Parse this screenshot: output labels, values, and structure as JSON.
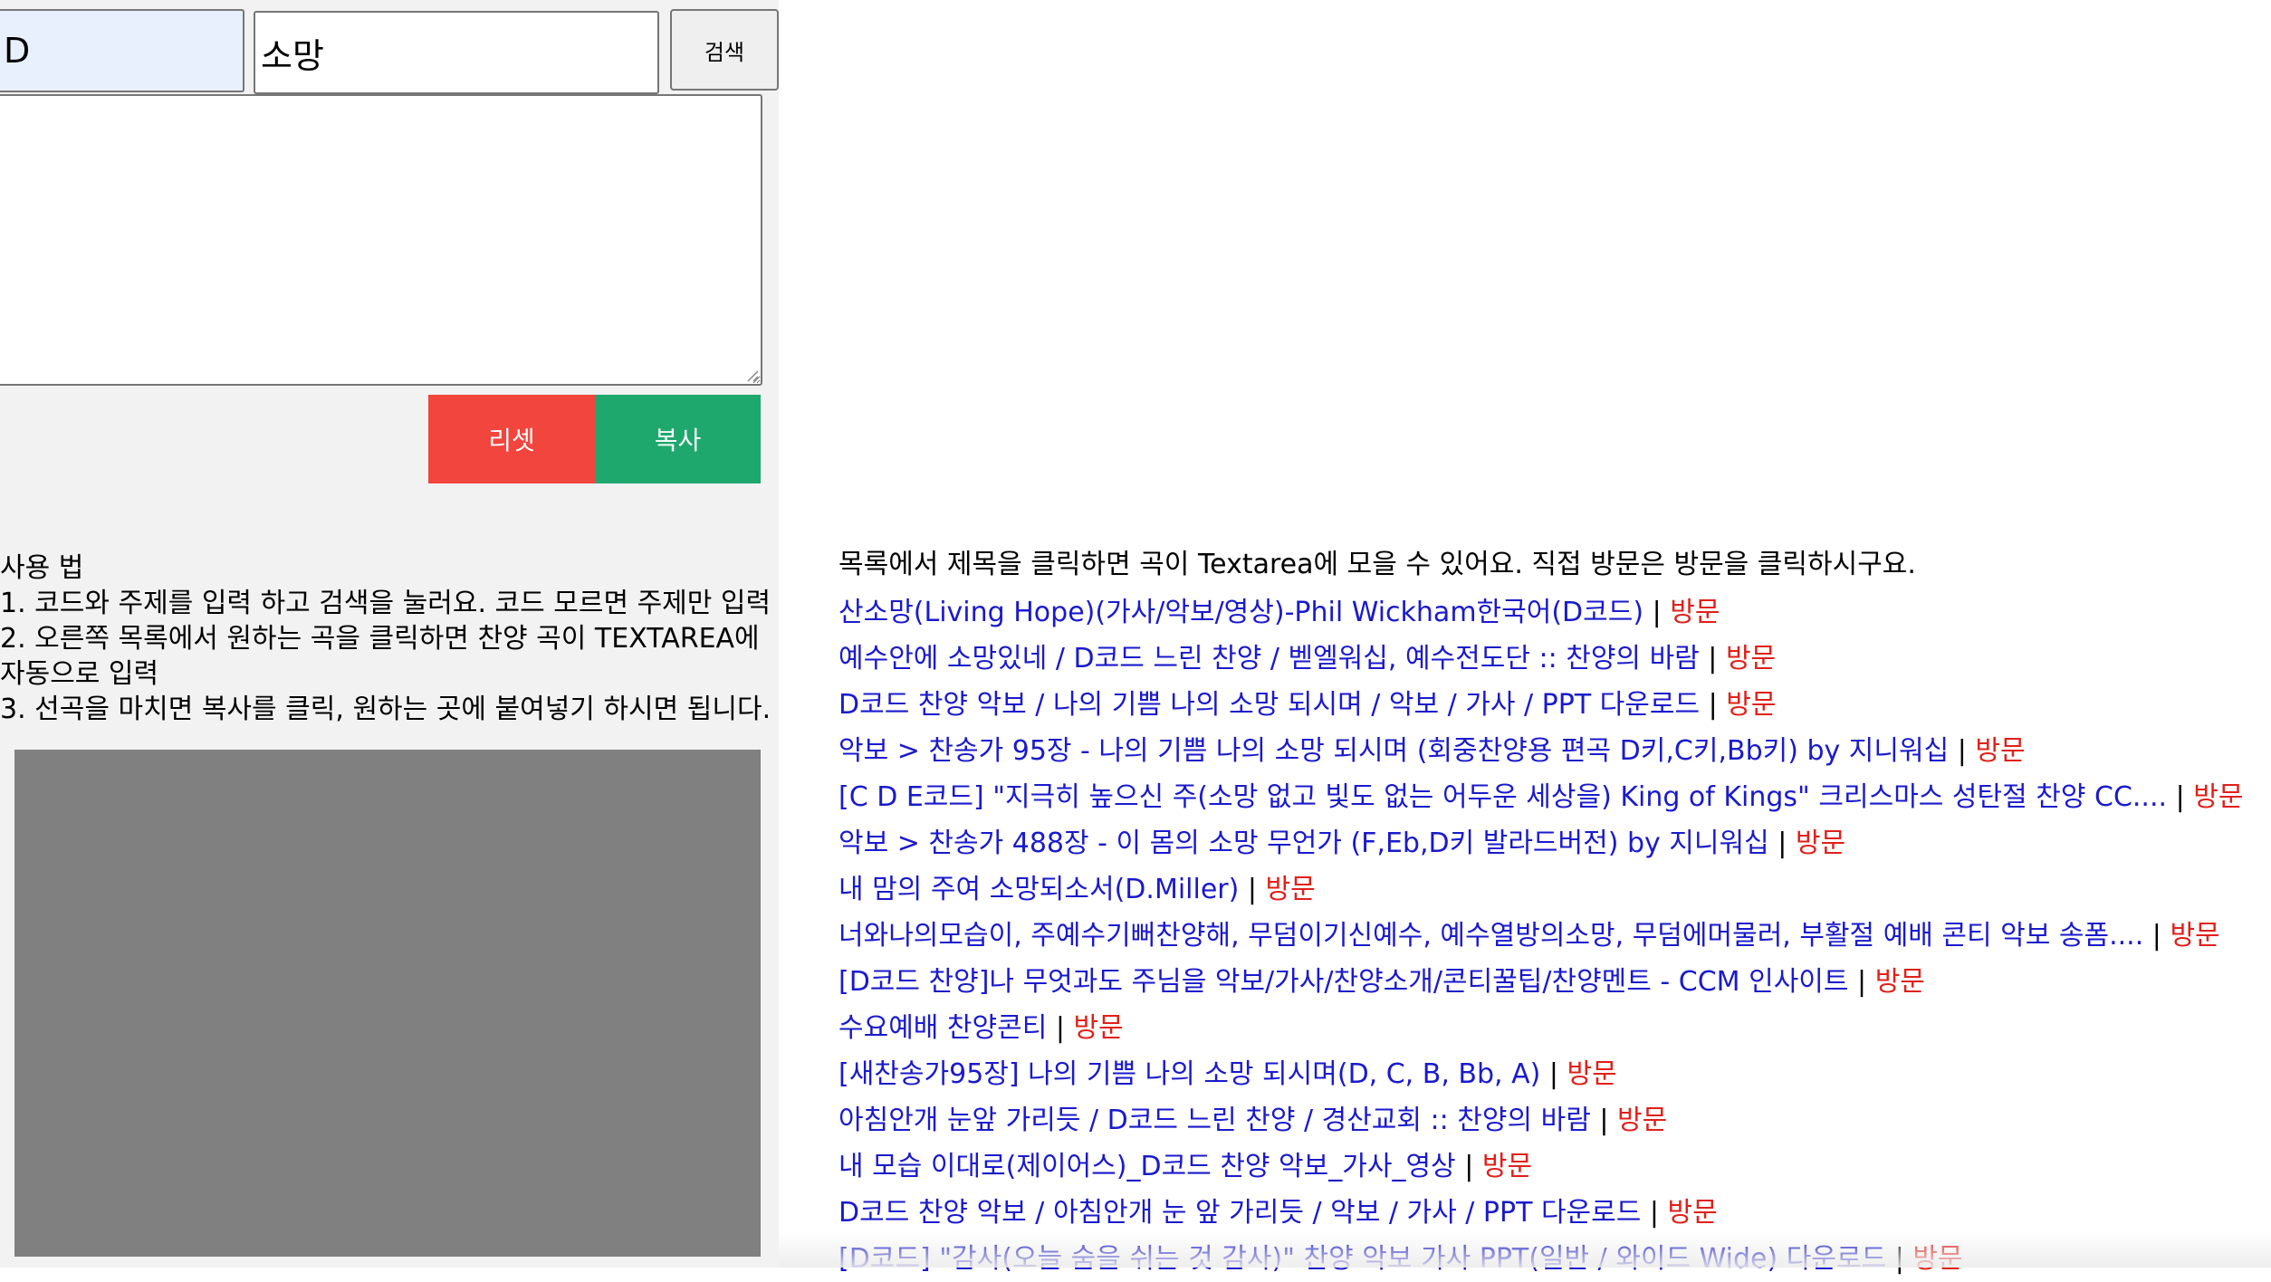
{
  "search": {
    "code_value": "D",
    "topic_value": "소망",
    "button_label": "검색"
  },
  "editor": {
    "textarea_value": ""
  },
  "actions": {
    "reset_label": "리셋",
    "copy_label": "복사"
  },
  "usage": {
    "title": "사용 법",
    "steps": [
      "1. 코드와 주제를 입력 하고 검색을 눌러요. 코드 모르면 주제만 입력",
      "2. 오른쪽 목록에서 원하는 곡을 클릭하면 찬양 곡이 TEXTAREA에 자동으로 입력",
      "3. 선곡을 마치면 복사를 클릭, 원하는 곳에 붙여넣기 하시면 됩니다."
    ]
  },
  "results": {
    "intro": "목록에서 제목을 클릭하면 곡이 Textarea에 모을 수 있어요. 직접 방문은 방문을 클릭하시구요.",
    "separator": " | ",
    "visit_label": "방문",
    "items": [
      {
        "title": "산소망(Living Hope)(가사/악보/영상)-Phil Wickham한국어(D코드)"
      },
      {
        "title": "예수안에 소망있네 / D코드 느린 찬양 / 벧엘워십, 예수전도단 :: 찬양의 바람"
      },
      {
        "title": "D코드 찬양 악보 / 나의 기쁨 나의 소망 되시며 / 악보 / 가사 / PPT 다운로드"
      },
      {
        "title": "악보 > 찬송가 95장 - 나의 기쁨 나의 소망 되시며 (회중찬양용 편곡 D키,C키,Bb키) by 지니워십"
      },
      {
        "title": "[C D E코드] \"지극히 높으신 주(소망 없고 빛도 없는 어두운 세상을) King of Kings\" 크리스마스 성탄절 찬양 CC...."
      },
      {
        "title": "악보 > 찬송가 488장 - 이 몸의 소망 무언가 (F,Eb,D키 발라드버전) by 지니워십"
      },
      {
        "title": "내 맘의 주여 소망되소서(D.Miller)"
      },
      {
        "title": "너와나의모습이, 주예수기뻐찬양해, 무덤이기신예수, 예수열방의소망, 무덤에머물러, 부활절 예배 콘티 악보 송폼...."
      },
      {
        "title": "[D코드 찬양]나 무엇과도 주님을 악보/가사/찬양소개/콘티꿀팁/찬양멘트 - CCM 인사이트"
      },
      {
        "title": "수요예배 찬양콘티"
      },
      {
        "title": "[새찬송가95장] 나의 기쁨 나의 소망 되시며(D, C, B, Bb, A)"
      },
      {
        "title": "아침안개 눈앞 가리듯 / D코드 느린 찬양 / 경산교회 :: 찬양의 바람"
      },
      {
        "title": "내 모습 이대로(제이어스)_D코드 찬양 악보_가사_영상"
      },
      {
        "title": "D코드 찬양 악보 / 아침안개 눈 앞 가리듯 / 악보 / 가사 / PPT 다운로드"
      },
      {
        "title": "[D코드] \"감사(오늘 숨을 쉬는 것 감사)\" 찬양 악보 가사 PPT(일반 / 와이드 Wide) 다운로드"
      }
    ]
  }
}
